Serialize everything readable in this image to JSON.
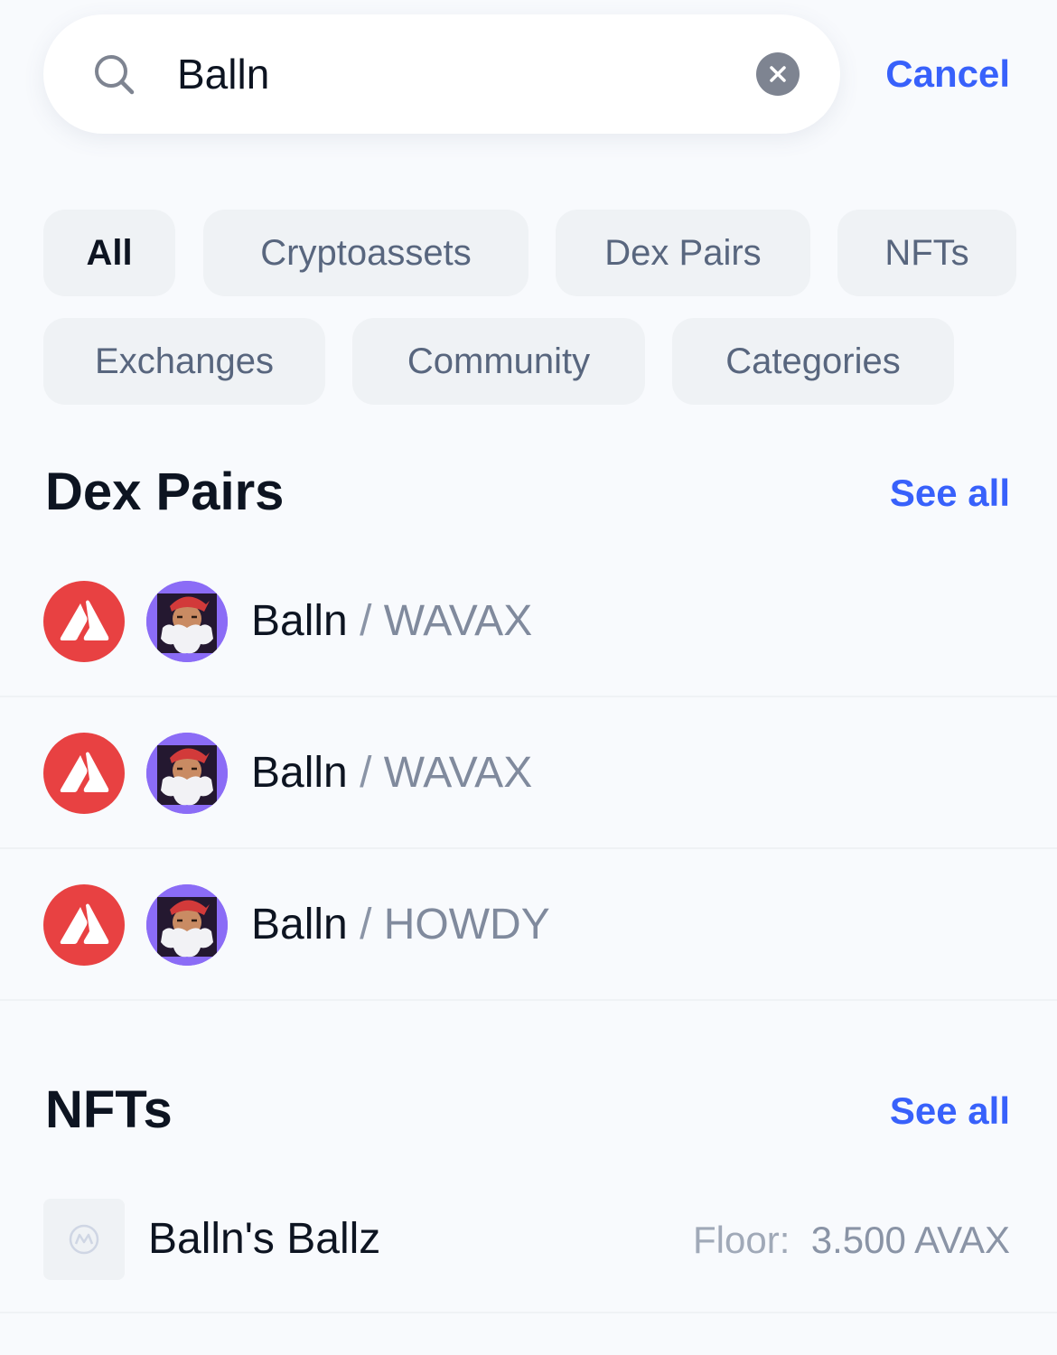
{
  "search": {
    "value": "Balln",
    "cancel_label": "Cancel"
  },
  "filters": [
    {
      "label": "All",
      "active": true
    },
    {
      "label": "Cryptoassets",
      "active": false
    },
    {
      "label": "Dex Pairs",
      "active": false
    },
    {
      "label": "NFTs",
      "active": false
    },
    {
      "label": "Exchanges",
      "active": false
    },
    {
      "label": "Community",
      "active": false
    },
    {
      "label": "Categories",
      "active": false
    }
  ],
  "dex_pairs": {
    "title": "Dex Pairs",
    "see_all": "See all",
    "items": [
      {
        "base": "Balln",
        "separator": " / ",
        "quote": "WAVAX",
        "chain_icon": "avalanche-icon",
        "token_icon": "balln-token-icon"
      },
      {
        "base": "Balln",
        "separator": " / ",
        "quote": "WAVAX",
        "chain_icon": "avalanche-icon",
        "token_icon": "balln-token-icon"
      },
      {
        "base": "Balln",
        "separator": " / ",
        "quote": "HOWDY",
        "chain_icon": "avalanche-icon",
        "token_icon": "balln-token-icon"
      }
    ]
  },
  "nfts": {
    "title": "NFTs",
    "see_all": "See all",
    "items": [
      {
        "name": "Balln's Ballz",
        "floor_label": "Floor:",
        "floor_value": "3.500 AVAX",
        "icon": "placeholder-logo-icon"
      }
    ]
  },
  "colors": {
    "accent": "#3861FB",
    "avalanche_red": "#E84142",
    "background": "#F8FAFD",
    "chip_bg": "#EFF2F5"
  }
}
